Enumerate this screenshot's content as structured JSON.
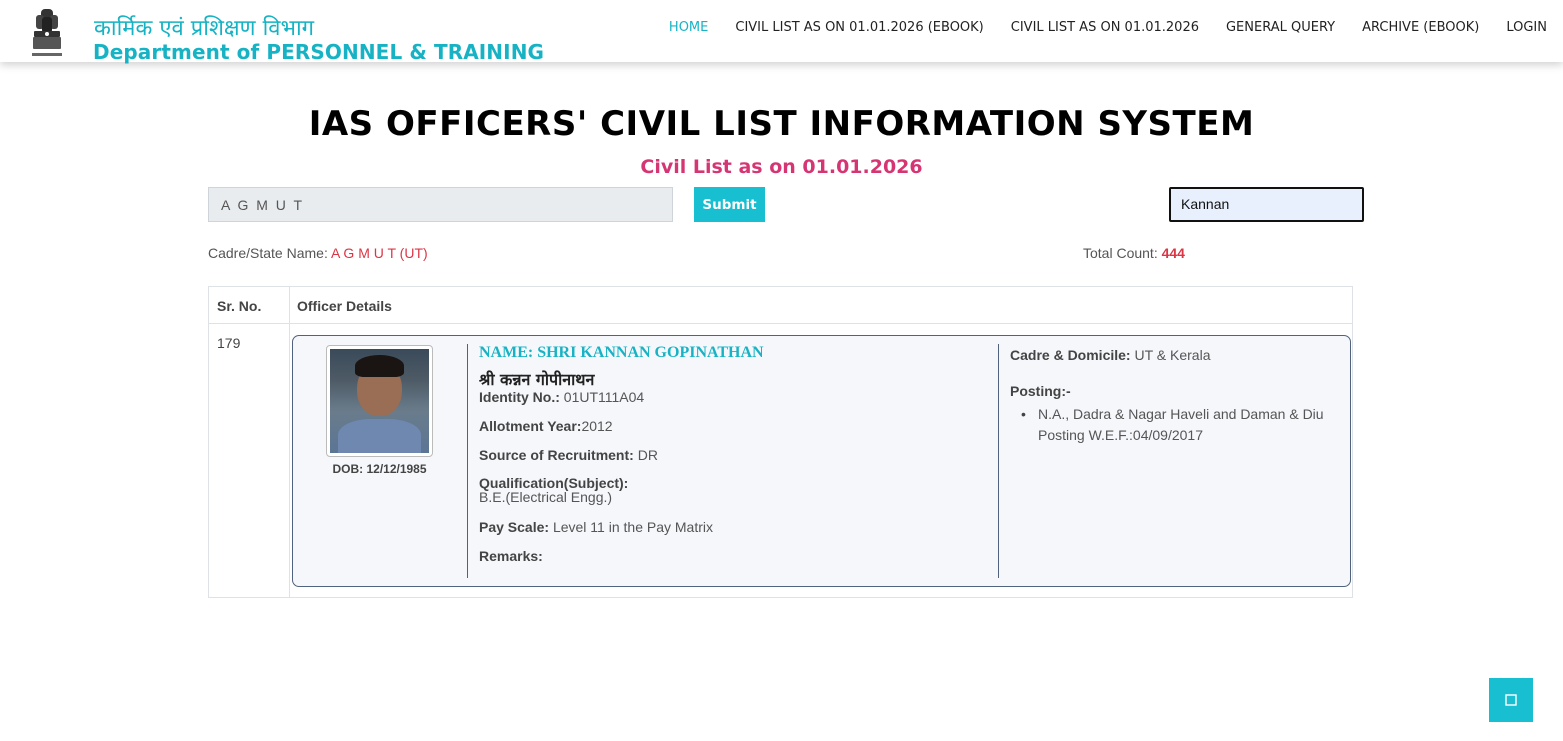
{
  "header": {
    "brand_hindi": "कार्मिक एवं प्रशिक्षण विभाग",
    "brand_english": "Department of PERSONNEL & TRAINING",
    "emblem_icon": "national-emblem-icon",
    "nav": [
      {
        "label": "HOME",
        "active": true
      },
      {
        "label": "CIVIL LIST AS ON 01.01.2026 (EBOOK)"
      },
      {
        "label": "CIVIL LIST AS ON 01.01.2026"
      },
      {
        "label": "GENERAL QUERY"
      },
      {
        "label": "ARCHIVE (EBOOK)"
      },
      {
        "label": "LOGIN"
      }
    ]
  },
  "main": {
    "title": "IAS OFFICERS' CIVIL LIST INFORMATION SYSTEM",
    "subtitle": "Civil List as on 01.01.2026",
    "cadre_select_value": "A G M U T",
    "submit_label": "Submit",
    "search_value": "Kannan",
    "cadre_label": "Cadre/State Name: ",
    "cadre_value": "A G M U T (UT)",
    "count_label": "Total Count: ",
    "count_value": "444"
  },
  "table": {
    "headers": [
      "Sr. No.",
      "Officer Details"
    ],
    "rows": [
      {
        "sr_no": "179",
        "dob": "DOB: 12/12/1985",
        "name_en": "NAME: SHRI KANNAN GOPINATHAN",
        "name_hi": "श्री कन्नन गोपीनाथन",
        "identity_label": "Identity No.:",
        "identity_value": " 01UT111A04",
        "allotment_label": "Allotment Year:",
        "allotment_value": "2012",
        "source_label": "Source of Recruitment:",
        "source_value": " DR",
        "qualification_label": "Qualification(Subject):",
        "qualification_value": "B.E.(Electrical Engg.)",
        "payscale_label": "Pay Scale:",
        "payscale_value": " Level 11 in the Pay Matrix",
        "remarks_label": "Remarks:",
        "cadre_domicile_label": "Cadre & Domicile:",
        "cadre_domicile_value": " UT & Kerala",
        "posting_label": "Posting:-",
        "posting_line1": "N.A., Dadra & Nagar Haveli and Daman & Diu",
        "posting_line2": "Posting W.E.F.:04/09/2017"
      }
    ]
  },
  "scroll_top_icon": "arrow-up-icon",
  "colors": {
    "accent": "#17b3c4",
    "pink": "#d63574",
    "red": "#dc3545"
  }
}
